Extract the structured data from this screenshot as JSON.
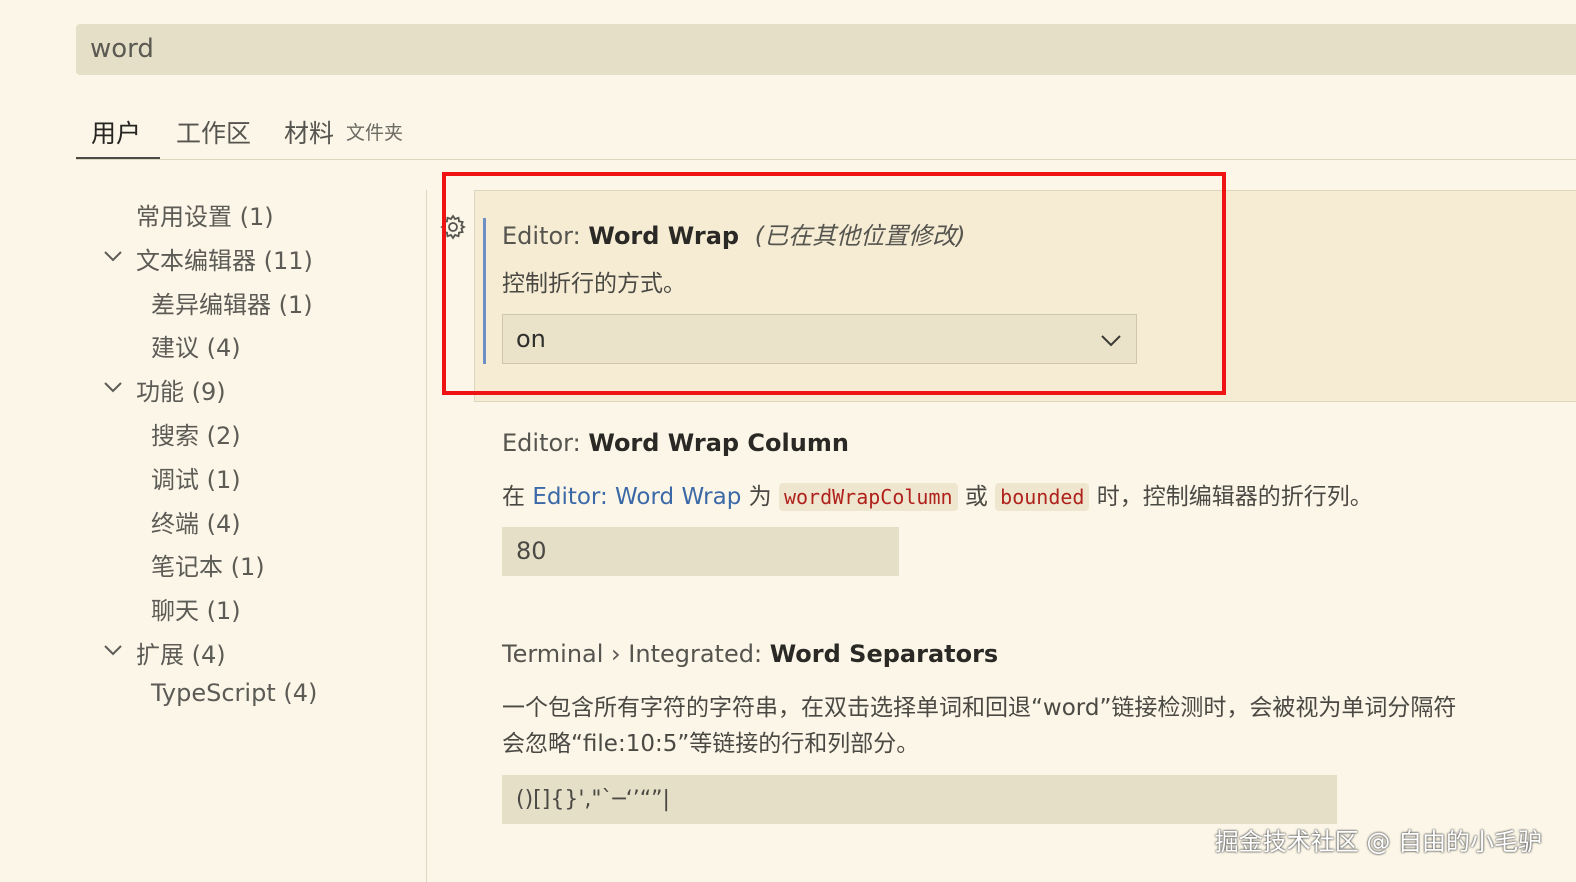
{
  "search": {
    "value": "word"
  },
  "tabs": {
    "user": "用户",
    "workspace": "工作区",
    "folder": "材料",
    "folder_sub": "文件夹"
  },
  "sidebar": {
    "items": [
      {
        "label": "常用设置 (1)"
      },
      {
        "label": "文本编辑器 (11)"
      },
      {
        "label": "差异编辑器 (1)"
      },
      {
        "label": "建议 (4)"
      },
      {
        "label": "功能 (9)"
      },
      {
        "label": "搜索 (2)"
      },
      {
        "label": "调试 (1)"
      },
      {
        "label": "终端 (4)"
      },
      {
        "label": "笔记本 (1)"
      },
      {
        "label": "聊天 (1)"
      },
      {
        "label": "扩展 (4)"
      },
      {
        "label": "TypeScript (4)"
      }
    ]
  },
  "settings": {
    "word_wrap": {
      "category": "Editor: ",
      "name": "Word Wrap",
      "modified": "(已在其他位置修改)",
      "description": "控制折行的方式。",
      "value": "on"
    },
    "word_wrap_column": {
      "category": "Editor: ",
      "name": "Word Wrap Column",
      "desc_prefix": "在 ",
      "desc_link": "Editor: Word Wrap",
      "desc_mid": " 为 ",
      "desc_code1": "wordWrapColumn",
      "desc_or": " 或 ",
      "desc_code2": "bounded",
      "desc_suffix": " 时，控制编辑器的折行列。",
      "value": "80"
    },
    "word_separators": {
      "category": "Terminal › Integrated: ",
      "name": "Word Separators",
      "description_line1": "一个包含所有字符的字符串，在双击选择单词和回退“word”链接检测时，会被视为单词分隔符",
      "description_line2": "会忽略“file:10:5”等链接的行和列部分。",
      "value": " ()[]{}',\"`─‘’“”|"
    }
  },
  "watermark": "掘金技术社区 @ 自由的小毛驴"
}
